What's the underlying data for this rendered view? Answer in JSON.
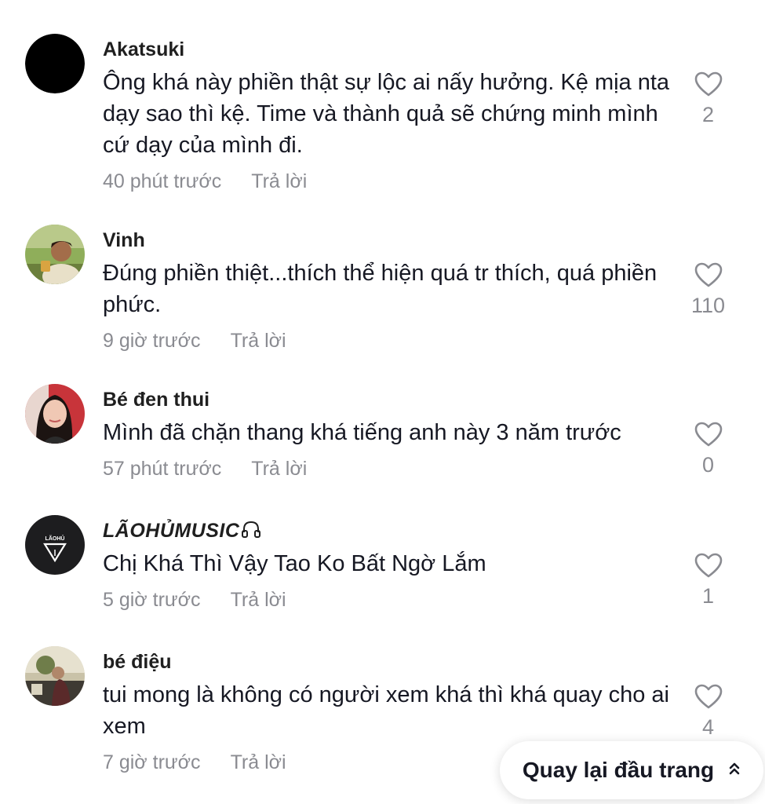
{
  "comments": [
    {
      "username": "Akatsuki",
      "text": "Ông khá này phiền thật sự lộc ai nấy hưởng. Kệ mịa nta dạy sao thì kệ. Time và thành quả sẽ chứng minh mình cứ dạy của mình đi.",
      "time": "40 phút trước",
      "reply_label": "Trả lời",
      "likes": "2"
    },
    {
      "username": "Vinh",
      "text": "Đúng phiền thiệt...thích thể hiện quá tr thích, quá phiền phức.",
      "time": "9 giờ trước",
      "reply_label": "Trả lời",
      "likes": "110"
    },
    {
      "username": "Bé đen thui",
      "text": "Mình đã chặn thang khá tiếng anh này 3 năm trước",
      "time": "57 phút trước",
      "reply_label": "Trả lời",
      "likes": "0"
    },
    {
      "username": "LÃOHỦMUSIC",
      "text": "Chị Khá Thì Vậy Tao Ko Bất Ngờ Lắm",
      "time": "5 giờ trước",
      "reply_label": "Trả lời",
      "likes": "1",
      "avatar_text": "LÃOHỦ"
    },
    {
      "username": "bé điệu",
      "text": "tui mong là không có người xem khá thì khá quay cho ai xem",
      "time": "7 giờ trước",
      "reply_label": "Trả lời",
      "likes": "4"
    }
  ],
  "back_to_top": {
    "label": "Quay lại đầu trang"
  },
  "icons": {
    "like": "heart-outline-icon",
    "back_to_top": "double-chevron-up-icon",
    "username_badge": "headphones-icon"
  },
  "colors": {
    "text": "#161823",
    "muted": "#8a8b91",
    "background": "#ffffff"
  }
}
